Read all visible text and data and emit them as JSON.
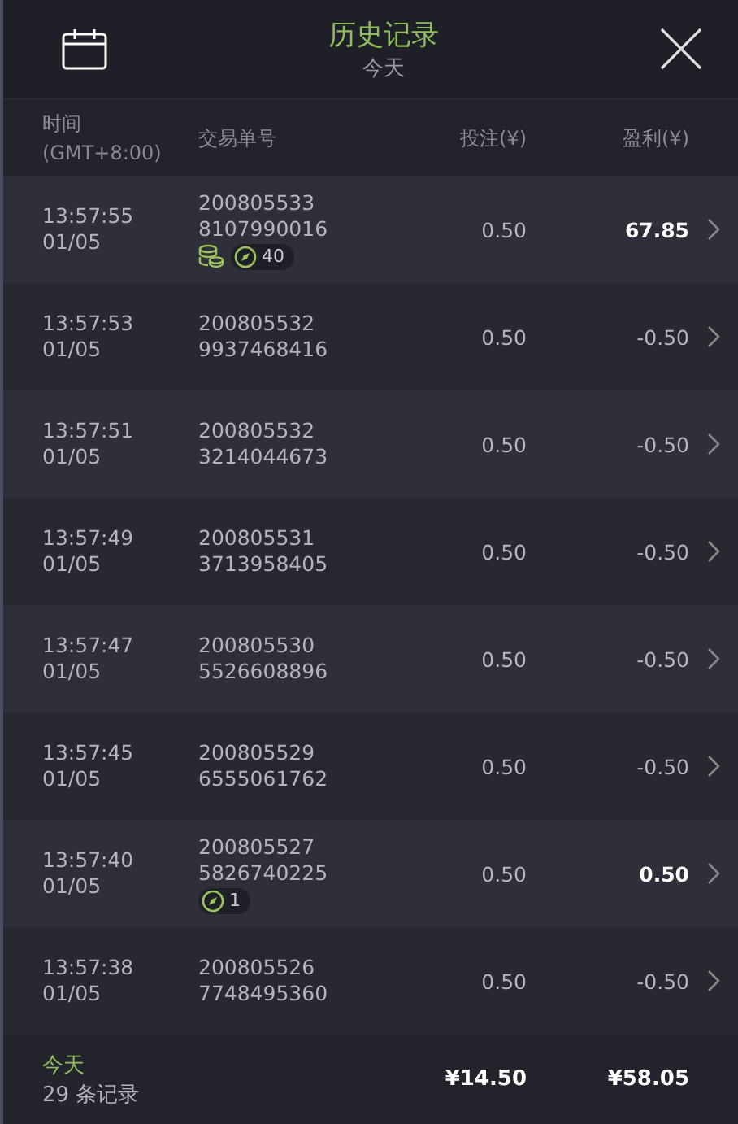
{
  "header": {
    "title": "历史记录",
    "subtitle": "今天"
  },
  "columns": {
    "time": "时间",
    "timezone": "(GMT+8:00)",
    "order": "交易单号",
    "stake": "投注(¥)",
    "profit": "盈利(¥)"
  },
  "rows": [
    {
      "time": "13:57:55",
      "date": "01/05",
      "order_a": "200805533",
      "order_b": "8107990016",
      "stake": "0.50",
      "profit": "67.85",
      "win": true,
      "badges": [
        {
          "kind": "coins"
        },
        {
          "kind": "count",
          "text": "40"
        }
      ]
    },
    {
      "time": "13:57:53",
      "date": "01/05",
      "order_a": "200805532",
      "order_b": "9937468416",
      "stake": "0.50",
      "profit": "-0.50",
      "win": false
    },
    {
      "time": "13:57:51",
      "date": "01/05",
      "order_a": "200805532",
      "order_b": "3214044673",
      "stake": "0.50",
      "profit": "-0.50",
      "win": false
    },
    {
      "time": "13:57:49",
      "date": "01/05",
      "order_a": "200805531",
      "order_b": "3713958405",
      "stake": "0.50",
      "profit": "-0.50",
      "win": false
    },
    {
      "time": "13:57:47",
      "date": "01/05",
      "order_a": "200805530",
      "order_b": "5526608896",
      "stake": "0.50",
      "profit": "-0.50",
      "win": false
    },
    {
      "time": "13:57:45",
      "date": "01/05",
      "order_a": "200805529",
      "order_b": "6555061762",
      "stake": "0.50",
      "profit": "-0.50",
      "win": false
    },
    {
      "time": "13:57:40",
      "date": "01/05",
      "order_a": "200805527",
      "order_b": "5826740225",
      "stake": "0.50",
      "profit": "0.50",
      "win": true,
      "badges": [
        {
          "kind": "count",
          "text": "1"
        }
      ]
    },
    {
      "time": "13:57:38",
      "date": "01/05",
      "order_a": "200805526",
      "order_b": "7748495360",
      "stake": "0.50",
      "profit": "-0.50",
      "win": false
    }
  ],
  "footer": {
    "label": "今天",
    "count": "29 条记录",
    "stake_total": "¥14.50",
    "profit_total": "¥58.05"
  }
}
